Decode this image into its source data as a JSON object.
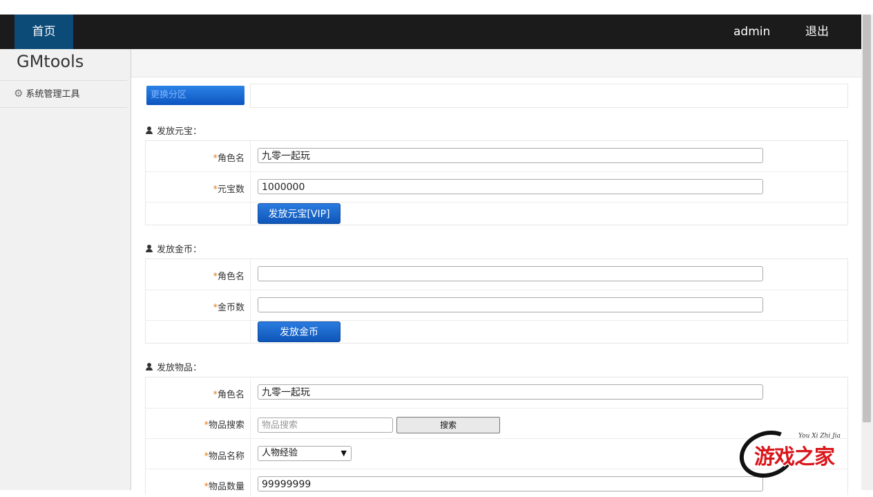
{
  "navbar": {
    "home": "首页",
    "user": "admin",
    "logout": "退出"
  },
  "sidebar": {
    "brand": "GMtools",
    "items": [
      {
        "label": "系统管理工具",
        "icon": "gear-icon"
      }
    ]
  },
  "switch_zone": {
    "label": "更换分区"
  },
  "yuanbao": {
    "title": "发放元宝：",
    "role_label": "角色名",
    "role_value": "九零一起玩",
    "amount_label": "元宝数",
    "amount_value": "1000000",
    "submit": "发放元宝[VIP]"
  },
  "gold": {
    "title": "发放金币：",
    "role_label": "角色名",
    "role_value": "",
    "amount_label": "金币数",
    "amount_value": "",
    "submit": "发放金币"
  },
  "item": {
    "title": "发放物品：",
    "role_label": "角色名",
    "role_value": "九零一起玩",
    "search_label": "物品搜索",
    "search_placeholder": "物品搜索",
    "search_button": "搜索",
    "name_label": "物品名称",
    "name_selected": "人物经验",
    "qty_label": "物品数量",
    "qty_value": "99999999"
  },
  "watermark": {
    "text": "游戏之家",
    "small": "You Xi Zhi Jia"
  },
  "colors": {
    "navbar": "#1b1b1b",
    "active_nav": "#0c4a78",
    "button": "#0f56b8",
    "required_star": "#e07b1a"
  }
}
